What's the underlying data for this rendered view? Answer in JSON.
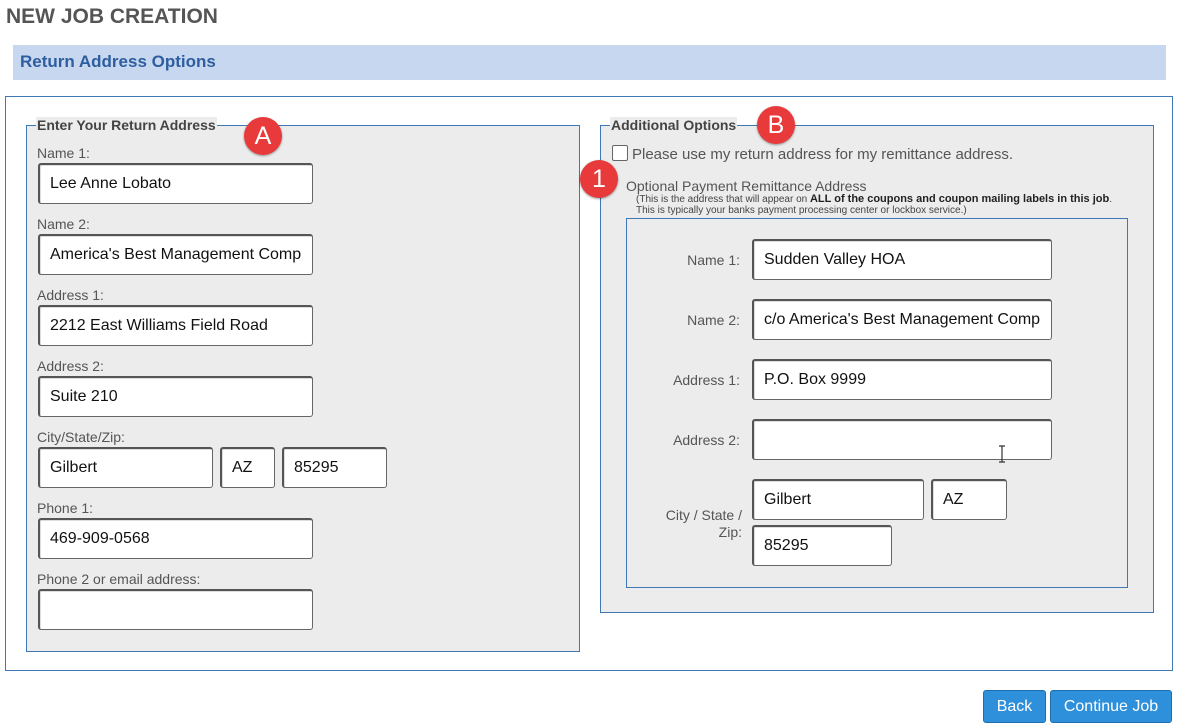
{
  "page_title": "NEW JOB CREATION",
  "section_title": "Return Address Options",
  "return_address": {
    "legend": "Enter Your Return Address",
    "marker": "A",
    "name1_label": "Name 1:",
    "name1_value": "Lee Anne Lobato",
    "name2_label": "Name 2:",
    "name2_value": "America's Best Management Comp",
    "address1_label": "Address 1:",
    "address1_value": "2212 East Williams Field Road",
    "address2_label": "Address 2:",
    "address2_value": "Suite 210",
    "csz_label": "City/State/Zip:",
    "city_value": "Gilbert",
    "state_value": "AZ",
    "zip_value": "85295",
    "phone1_label": "Phone 1:",
    "phone1_value": "469-909-0568",
    "phone2_label": "Phone 2 or email address:",
    "phone2_value": ""
  },
  "additional": {
    "legend": "Additional Options",
    "marker_b": "B",
    "marker_1": "1",
    "checkbox_label": "Please use my return address for my remittance address.",
    "checkbox_checked": false,
    "optional_title": "Optional Payment Remittance Address",
    "note_prefix": "(This is the address that will appear on ",
    "note_bold": "ALL of the coupons and coupon mailing labels in this job",
    "note_suffix": ". This is typically your banks payment processing center or lockbox service.)",
    "name1_label": "Name 1:",
    "name1_value": "Sudden Valley HOA",
    "name2_label": "Name 2:",
    "name2_value": "c/o America's Best Management Comp",
    "address1_label": "Address 1:",
    "address1_value": "P.O. Box 9999",
    "address2_label": "Address 2:",
    "address2_value": "",
    "csz_label": "City / State / Zip:",
    "city_value": "Gilbert",
    "state_value": "AZ",
    "zip_value": "85295"
  },
  "buttons": {
    "back": "Back",
    "continue": "Continue Job"
  },
  "colors": {
    "accent": "#2e8fdb",
    "section_bar": "#c7d7ef",
    "section_text": "#2e5e9f",
    "marker": "#e83a3a",
    "border": "#3f78b5"
  }
}
